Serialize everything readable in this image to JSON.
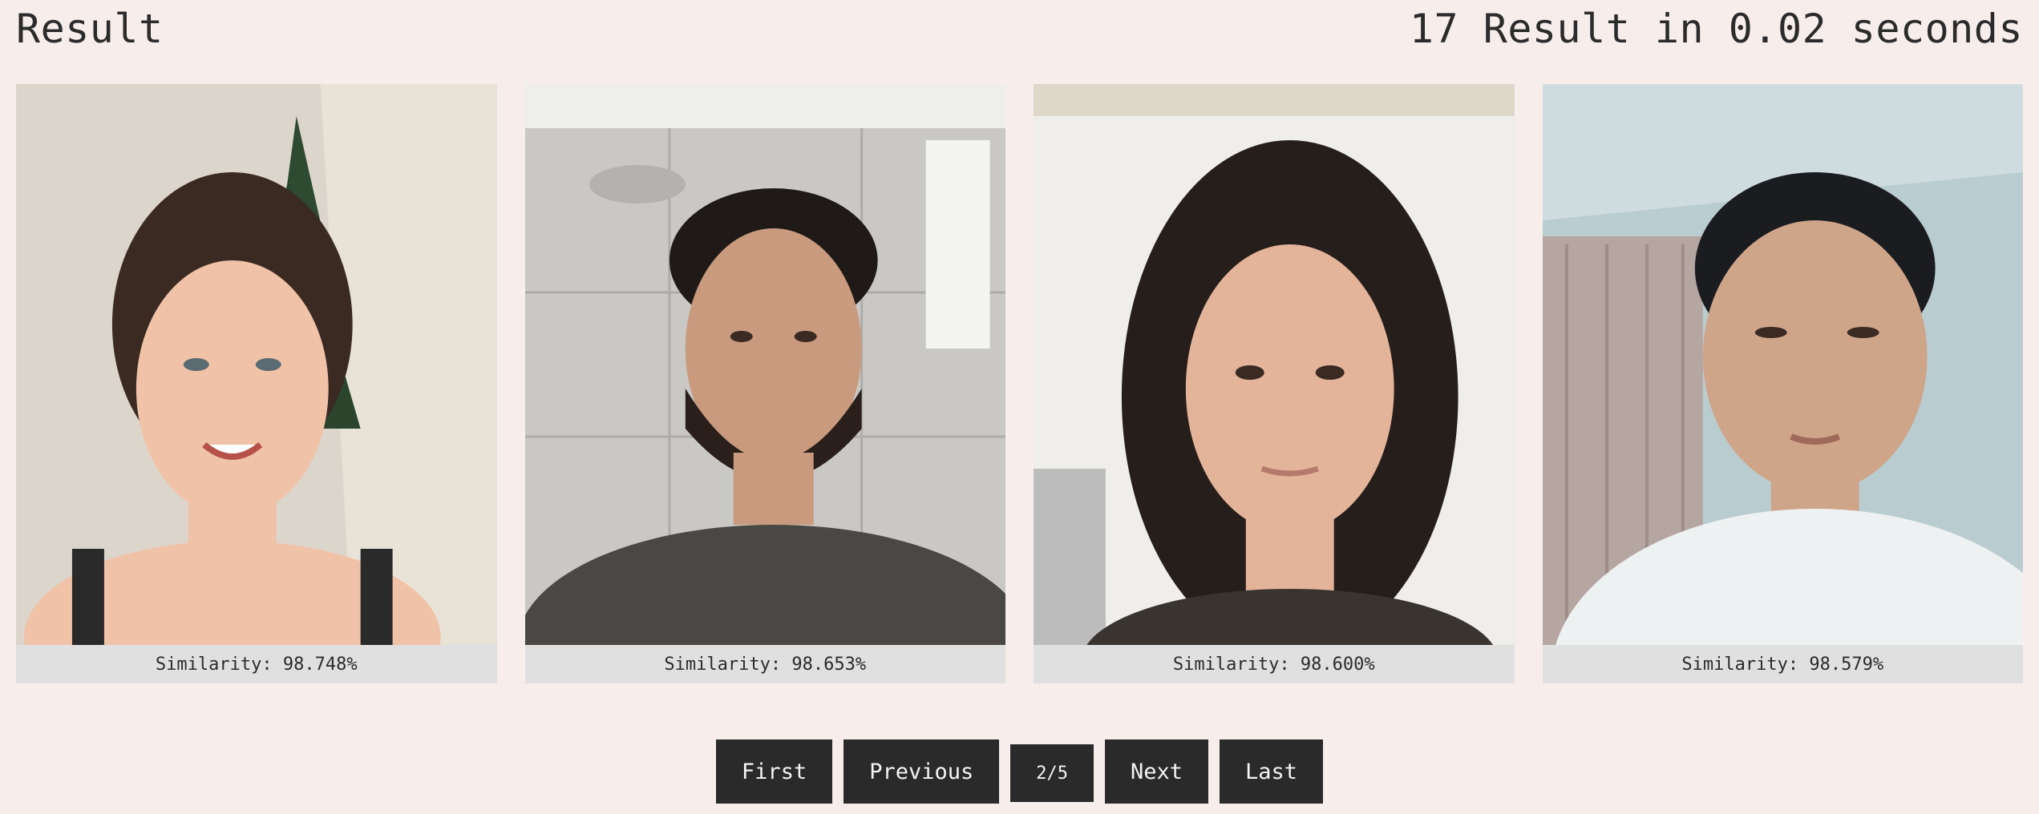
{
  "header": {
    "title": "Result",
    "count_text": "17 Result in 0.02 seconds"
  },
  "results": [
    {
      "similarity": "Similarity: 98.748%",
      "photo": {
        "background": "#dcd5cc",
        "skin": "#f0c2a8",
        "hair": "#3a2a22",
        "clothing": "#2a2a2a",
        "description_icon": "face-photo-icon"
      }
    },
    {
      "similarity": "Similarity: 98.653%",
      "photo": {
        "background": "#c9c8c4",
        "skin": "#c99a7d",
        "hair": "#1f1a17",
        "clothing": "#4a4744",
        "description_icon": "face-photo-icon"
      }
    },
    {
      "similarity": "Similarity: 98.600%",
      "photo": {
        "background": "#efeeea",
        "skin": "#e3b39a",
        "hair": "#261e1a",
        "clothing": "#3a3431",
        "description_icon": "face-photo-icon"
      }
    },
    {
      "similarity": "Similarity: 98.579%",
      "photo": {
        "background": "#b9ccd0",
        "skin": "#cfa58a",
        "hair": "#1a1c20",
        "clothing": "#eef1f2",
        "description_icon": "face-photo-icon"
      }
    }
  ],
  "pagination": {
    "first": "First",
    "previous": "Previous",
    "current": "2/5",
    "next": "Next",
    "last": "Last"
  }
}
